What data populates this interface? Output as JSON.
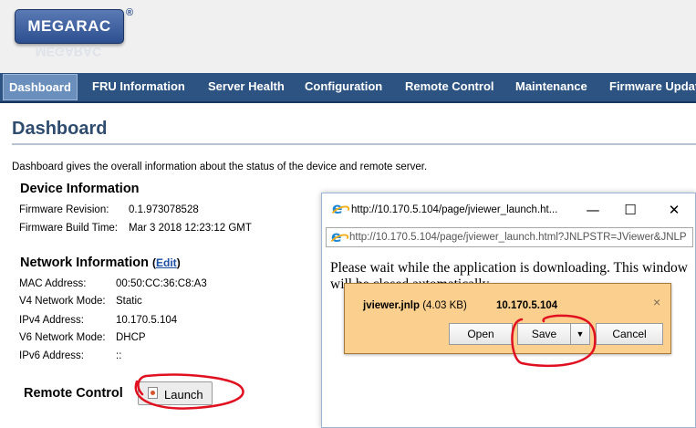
{
  "header": {
    "logo_text": "MEGARAC",
    "registered_mark": "®"
  },
  "nav": {
    "items": [
      {
        "label": "Dashboard",
        "active": true
      },
      {
        "label": "FRU Information"
      },
      {
        "label": "Server Health"
      },
      {
        "label": "Configuration"
      },
      {
        "label": "Remote Control"
      },
      {
        "label": "Maintenance"
      },
      {
        "label": "Firmware Updat"
      }
    ]
  },
  "dashboard": {
    "title": "Dashboard",
    "description": "Dashboard gives the overall information about the status of the device and remote server.",
    "device": {
      "heading": "Device Information",
      "firmware_revision_label": "Firmware Revision:",
      "firmware_revision": "0.1.973078528",
      "build_time_label": "Firmware Build Time:",
      "build_time": "Mar 3 2018 12:23:12 GMT"
    },
    "network": {
      "heading": "Network Information",
      "edit_open": "(",
      "edit_label": "Edit",
      "edit_close": ")",
      "rows": [
        {
          "label": "MAC Address:",
          "value": "00:50:CC:36:C8:A3"
        },
        {
          "label": "V4 Network Mode:",
          "value": "Static"
        },
        {
          "label": "IPv4 Address:",
          "value": "10.170.5.104"
        },
        {
          "label": "V6 Network Mode:",
          "value": "DHCP"
        },
        {
          "label": "IPv6 Address:",
          "value": "::"
        }
      ]
    },
    "remote_control": {
      "heading": "Remote Control",
      "launch_label": "Launch"
    }
  },
  "popup": {
    "title": "http://10.170.5.104/page/jviewer_launch.ht...",
    "minimize": "—",
    "maximize": "☐",
    "close": "✕",
    "address": "http://10.170.5.104/page/jviewer_launch.html?JNLPSTR=JViewer&JNLP",
    "message": "Please wait while the application is downloading. This window will be closed automatically."
  },
  "download_bar": {
    "file_name": "jviewer.jnlp",
    "file_size": "(4.03 KB)",
    "host": "10.170.5.104",
    "open_label": "Open",
    "save_label": "Save",
    "dropdown_glyph": "▼",
    "cancel_label": "Cancel",
    "close_glyph": "×"
  },
  "colors": {
    "nav_bg": "#2c5382",
    "download_bar_bg": "#fbcf8d",
    "annotation": "#e01020"
  }
}
